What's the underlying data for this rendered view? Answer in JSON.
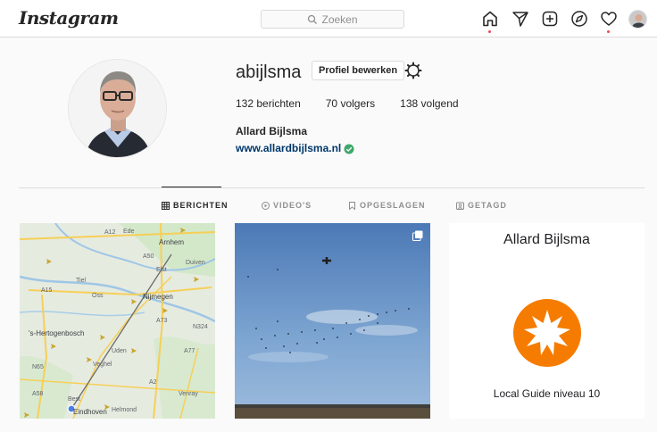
{
  "header": {
    "logo": "Instagram",
    "search_placeholder": "Zoeken",
    "icons": [
      "home-icon",
      "direct-icon",
      "new-post-icon",
      "explore-icon",
      "activity-icon",
      "profile-avatar"
    ]
  },
  "profile": {
    "username": "abijlsma",
    "edit_button": "Profiel bewerken",
    "stats": {
      "posts_count": "132",
      "posts_label": "berichten",
      "followers_count": "70",
      "followers_label": "volgers",
      "following_count": "138",
      "following_label": "volgend"
    },
    "full_name": "Allard Bijlsma",
    "website": "www.allardbijlsma.nl"
  },
  "tabs": [
    {
      "label": "BERICHTEN",
      "active": true
    },
    {
      "label": "VIDEO'S",
      "active": false
    },
    {
      "label": "OPGESLAGEN",
      "active": false
    },
    {
      "label": "GETAGD",
      "active": false
    }
  ],
  "posts": {
    "map_labels": [
      "A12",
      "Ede",
      "Arnhem",
      "A50",
      "Duiven",
      "Tiel",
      "A15",
      "Nijmegen",
      "Oss",
      "A73",
      "'s-Hertogenbosch",
      "Uden",
      "N65",
      "Veghel",
      "A77",
      "Best",
      "A58",
      "Eindhoven",
      "Helmond",
      "Venray",
      "A2",
      "Elst",
      "N324"
    ],
    "guide_name": "Allard Bijlsma",
    "guide_level": "Local Guide niveau 10"
  },
  "colors": {
    "accent_link": "#00376b",
    "notification_dot": "#ed4956",
    "verified": "#3ea76a",
    "guide_badge": "#f57c00"
  }
}
